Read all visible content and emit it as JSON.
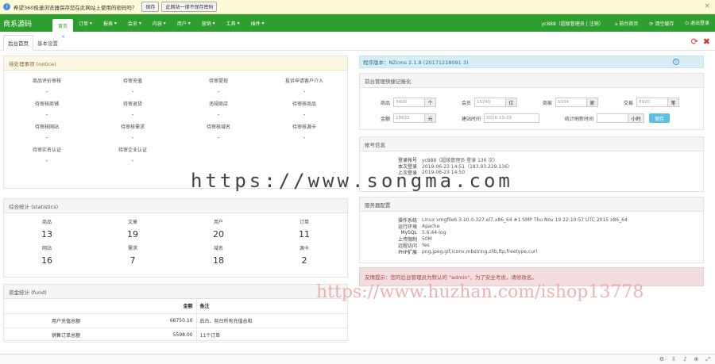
{
  "notice": {
    "message": "希望360极速浏览器保存您在此网站上使用的密码吗？",
    "save_label": "保存",
    "never_label": "此网站一律不保存密码"
  },
  "navbar": {
    "brand": "商系源码",
    "items": [
      "首页",
      "订单",
      "报表",
      "会员",
      "内容",
      "用户",
      "营销",
      "工具",
      "插件"
    ],
    "right": [
      "yc888（超级管理员 | 注销）",
      "前台首页",
      "清空缓存",
      "退出登录"
    ]
  },
  "tabs": [
    "后台首页",
    "基本设置"
  ],
  "todo": {
    "title": "待处理事项 (notice)",
    "items": [
      {
        "label": "商品评价审核",
        "value": "-"
      },
      {
        "label": "待审充值",
        "value": "-"
      },
      {
        "label": "待审提现",
        "value": "-"
      },
      {
        "label": "投诉申请客户介入",
        "value": "-"
      },
      {
        "label": "待审核商铺",
        "value": "-"
      },
      {
        "label": "待审退货",
        "value": "-"
      },
      {
        "label": "违规商店",
        "value": "-"
      },
      {
        "label": "待审核商品",
        "value": "-"
      },
      {
        "label": "待审核网站",
        "value": "-"
      },
      {
        "label": "待审核需求",
        "value": "-"
      },
      {
        "label": "待审核域名",
        "value": "-"
      },
      {
        "label": "待审核源卡",
        "value": "-"
      },
      {
        "label": "待审实名认证",
        "value": "-"
      },
      {
        "label": "待审企业认证",
        "value": "-"
      }
    ]
  },
  "statistics": {
    "title": "综合统计 (statistics)",
    "items": [
      {
        "label": "商品",
        "value": "13"
      },
      {
        "label": "文章",
        "value": "19"
      },
      {
        "label": "用户",
        "value": "20"
      },
      {
        "label": "订单",
        "value": "11"
      },
      {
        "label": "网站",
        "value": "16"
      },
      {
        "label": "需求",
        "value": "7"
      },
      {
        "label": "域名",
        "value": "18"
      },
      {
        "label": "源卡",
        "value": "2"
      }
    ]
  },
  "fund": {
    "title": "资金统计 (fund)",
    "headers": [
      "",
      "金额",
      "备注"
    ],
    "rows": [
      {
        "name": "用户充值总额",
        "amount": "66750.10",
        "remark": "后台、前台所有充值总和"
      },
      {
        "name": "销售订单总额",
        "amount": "5598.00",
        "remark": "11个订单"
      }
    ]
  },
  "version": {
    "label": "程序版本：NZcms 2.1.8 (20171218091 3)"
  },
  "quick_stats": {
    "title": "前台管理快捷记报化",
    "row1": [
      {
        "label": "商品",
        "value": "3400",
        "unit": "个"
      },
      {
        "label": "会员",
        "value": "15240",
        "unit": "位"
      },
      {
        "label": "商家",
        "value": "5034",
        "unit": "家"
      },
      {
        "label": "交易",
        "value": "8920",
        "unit": "笔"
      }
    ],
    "row2": [
      {
        "label": "金额",
        "value": "15632",
        "unit": "元"
      },
      {
        "label": "建站时间",
        "value": "2016-10-29",
        "unit": ""
      },
      {
        "label": "统计刷新时间",
        "value": "",
        "unit": "小时"
      }
    ],
    "save_label": "保存"
  },
  "account": {
    "title": "帐号信息",
    "rows": [
      {
        "key": "登录帐号",
        "value": "yc888（超级管理员 登录 136 次）"
      },
      {
        "key": "本次登录",
        "value": "2019-06-23 14:51（183.93.229.136）"
      },
      {
        "key": "上次登录",
        "value": "2019-06-23 14:50"
      }
    ]
  },
  "server": {
    "title": "服务器配置",
    "rows": [
      {
        "key": "操作系统",
        "value": "Linux vmgfile6 3.10.0-327.el7.x86_64 #1 SMP Thu Nov 19 22:10:57 UTC 2015 x86_64"
      },
      {
        "key": "运行环境",
        "value": "Apache"
      },
      {
        "key": "MySQL",
        "value": "5.6.44-log"
      },
      {
        "key": "上传限制",
        "value": "50M"
      },
      {
        "key": "远程访问",
        "value": "Yes"
      },
      {
        "key": "PHP扩展",
        "value": "png,jpeg,gif,iconv,mbstring,zlib,ftp,freetype,curl"
      }
    ]
  },
  "alert": {
    "text": "友情提示：您的后台管理员为默认的 \"admin\"，为了安全考虑，请修改名。"
  },
  "watermarks": [
    "https://www.songma.com",
    "https://www.huzhan.com/ishop13778"
  ],
  "colors": {
    "nav": "#2e9e2e",
    "accent": "#4a90d9",
    "danger": "#d9302c"
  }
}
